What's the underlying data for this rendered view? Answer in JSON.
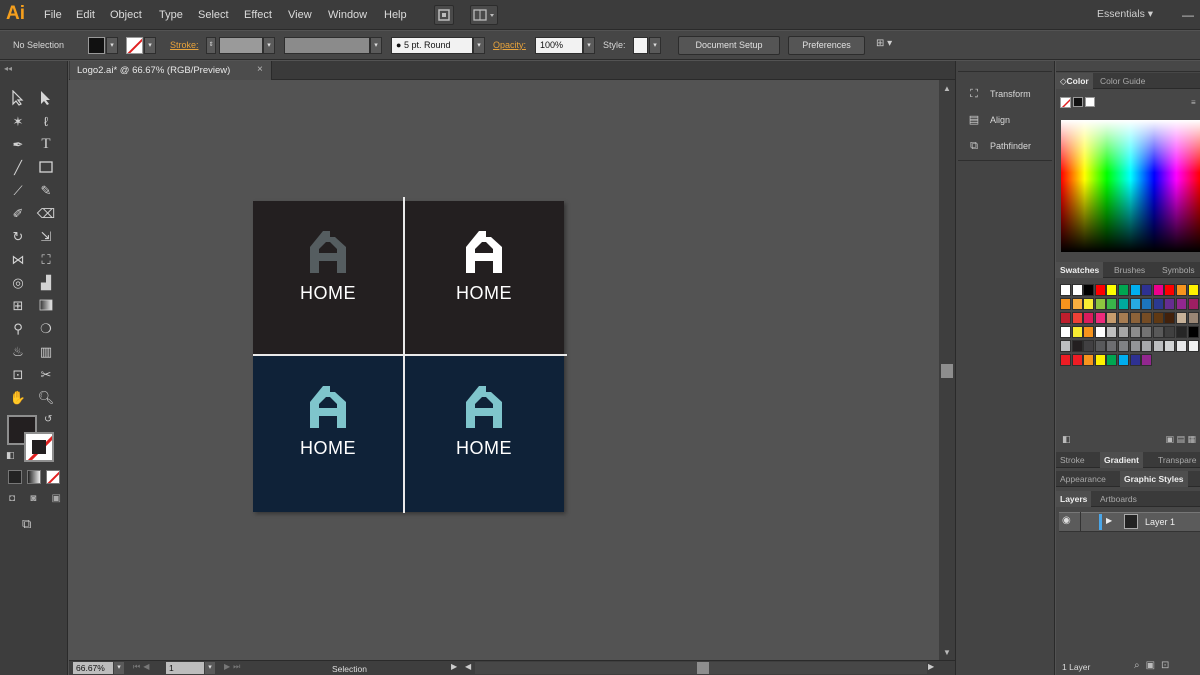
{
  "app": {
    "logo": "Ai"
  },
  "menu": [
    "File",
    "Edit",
    "Object",
    "Type",
    "Select",
    "Effect",
    "View",
    "Window",
    "Help"
  ],
  "workspace": "Essentials",
  "control": {
    "selection_state": "No Selection",
    "stroke_label": "Stroke:",
    "brush_value": "5 pt. Round",
    "opacity_label": "Opacity:",
    "opacity_value": "100%",
    "style_label": "Style:",
    "document_setup": "Document Setup",
    "preferences": "Preferences"
  },
  "document": {
    "tab_title": "Logo2.ai* @ 66.67% (RGB/Preview)",
    "close_glyph": "×"
  },
  "artboard": {
    "logos": [
      {
        "text": "HOME",
        "bg": "#231f20",
        "icon_color": "#555d60"
      },
      {
        "text": "HOME",
        "bg": "#231f20",
        "icon_color": "#ffffff"
      },
      {
        "text": "HOME",
        "bg": "#0f2238",
        "icon_color": "#7fc5cc"
      },
      {
        "text": "HOME",
        "bg": "#0f2238",
        "icon_color": "#7fc5cc"
      }
    ]
  },
  "status": {
    "zoom": "66.67%",
    "artboard_num": "1",
    "tool": "Selection"
  },
  "dock": [
    "Transform",
    "Align",
    "Pathfinder"
  ],
  "panels": {
    "color_tabs": [
      "Color",
      "Color Guide"
    ],
    "swatch_tabs": [
      "Swatches",
      "Brushes",
      "Symbols"
    ],
    "stroke_tabs": [
      "Stroke",
      "Gradient",
      "Transpare"
    ],
    "appearance_tabs": [
      "Appearance",
      "Graphic Styles"
    ],
    "layer_tabs": [
      "Layers",
      "Artboards"
    ],
    "layer_name": "Layer 1",
    "layer_count": "1 Layer"
  },
  "colors": {
    "accent": "#f59f1d",
    "stroke_label": "#e8a33b"
  }
}
